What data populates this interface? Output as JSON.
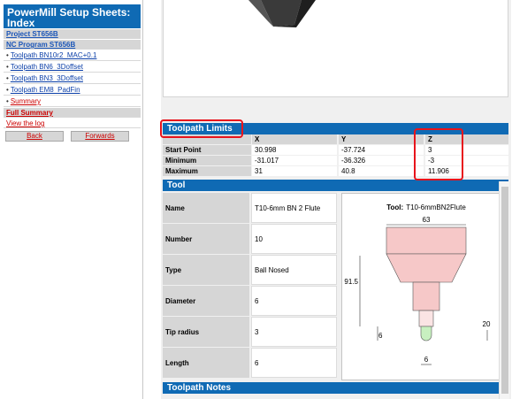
{
  "index": {
    "title": "PowerMill Setup Sheets: Index",
    "project_link": "Project ST656B",
    "nc_program_link": "NC Program ST656B",
    "toolpaths": [
      "Toolpath BN10r2_MAC+0.1",
      "Toolpath BN6_3Doffset",
      "Toolpath BN3_3Doffset",
      "Toolpath EM8_PadFin"
    ],
    "summary_link": "Summary",
    "full_summary_link": "Full Summary",
    "view_log_link": "View the log",
    "back_button": "Back",
    "forwards_button": "Forwards"
  },
  "limits": {
    "title": "Toolpath Limits",
    "columns": [
      "X",
      "Y",
      "Z"
    ],
    "rows": [
      {
        "label": "Start Point",
        "x": "30.998",
        "y": "-37.724",
        "z": "3"
      },
      {
        "label": "Minimum",
        "x": "-31.017",
        "y": "-36.326",
        "z": "-3"
      },
      {
        "label": "Maximum",
        "x": "31",
        "y": "40.8",
        "z": "11.906"
      }
    ]
  },
  "tool": {
    "title": "Tool",
    "properties": [
      {
        "label": "Name",
        "value": "T10-6mm BN 2 Flute"
      },
      {
        "label": "Number",
        "value": "10"
      },
      {
        "label": "Type",
        "value": "Ball Nosed"
      },
      {
        "label": "Diameter",
        "value": "6"
      },
      {
        "label": "Tip radius",
        "value": "3"
      },
      {
        "label": "Length",
        "value": "6"
      }
    ],
    "diagram": {
      "caption_prefix": "Tool:",
      "caption_name": "T10-6mmBN2Flute",
      "dim_holder_width": "63",
      "dim_overall_length": "91.5",
      "dim_tip_length": "6",
      "dim_shank_length": "20",
      "dim_tip_diameter": "6",
      "holder_color": "#f6c8c8",
      "tip_color": "#c8f0c0"
    }
  },
  "notes": {
    "title": "Toolpath Notes"
  },
  "annotation_color": "#e8141c",
  "header_color": "#0f6ab4"
}
